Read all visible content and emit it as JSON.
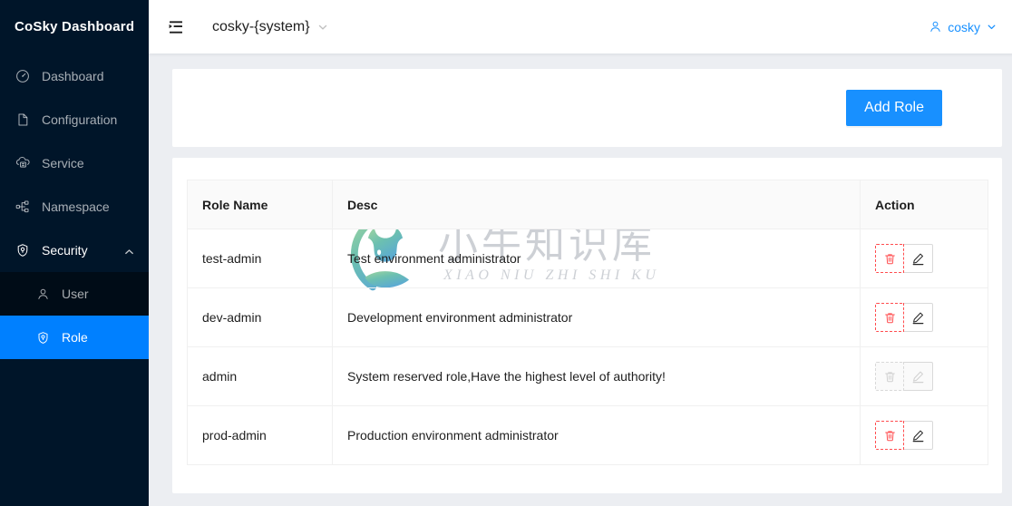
{
  "sidebar": {
    "brand": "CoSky Dashboard",
    "items": [
      {
        "label": "Dashboard",
        "icon": "dashboard-icon"
      },
      {
        "label": "Configuration",
        "icon": "file-icon"
      },
      {
        "label": "Service",
        "icon": "cloud-server-icon"
      },
      {
        "label": "Namespace",
        "icon": "sitemap-icon"
      },
      {
        "label": "Security",
        "icon": "shield-icon",
        "expanded": true
      }
    ],
    "submenu": [
      {
        "label": "User",
        "icon": "user-icon",
        "active": false
      },
      {
        "label": "Role",
        "icon": "shield-icon",
        "active": true
      }
    ]
  },
  "topbar": {
    "fold_icon": "menu-fold-icon",
    "system_label": "cosky-{system}",
    "system_chevron": "chevron-down-icon",
    "user_icon": "user-icon",
    "user_label": "cosky",
    "user_chevron": "chevron-down-icon"
  },
  "toolbar": {
    "add_role_label": "Add Role"
  },
  "table": {
    "columns": [
      "Role Name",
      "Desc",
      "Action"
    ],
    "rows": [
      {
        "name": "test-admin",
        "desc": "Test environment administrator",
        "delete_label": "delete-icon",
        "edit_label": "edit-icon",
        "disabled": false
      },
      {
        "name": "dev-admin",
        "desc": "Development environment administrator",
        "delete_label": "delete-icon",
        "edit_label": "edit-icon",
        "disabled": false
      },
      {
        "name": "admin",
        "desc": "System reserved role,Have the highest level of authority!",
        "delete_label": "delete-icon",
        "edit_label": "edit-icon",
        "disabled": true
      },
      {
        "name": "prod-admin",
        "desc": "Production environment administrator",
        "delete_label": "delete-icon",
        "edit_label": "edit-icon",
        "disabled": false
      }
    ]
  },
  "watermark": {
    "cn": "小牛知识库",
    "en": "XIAO NIU ZHI SHI KU"
  },
  "colors": {
    "sidebar_bg": "#001529",
    "submenu_bg": "#000c17",
    "accent": "#1890ff",
    "active_item": "#0080ff",
    "danger": "#ff4d4f",
    "content_bg": "#eceef2"
  }
}
